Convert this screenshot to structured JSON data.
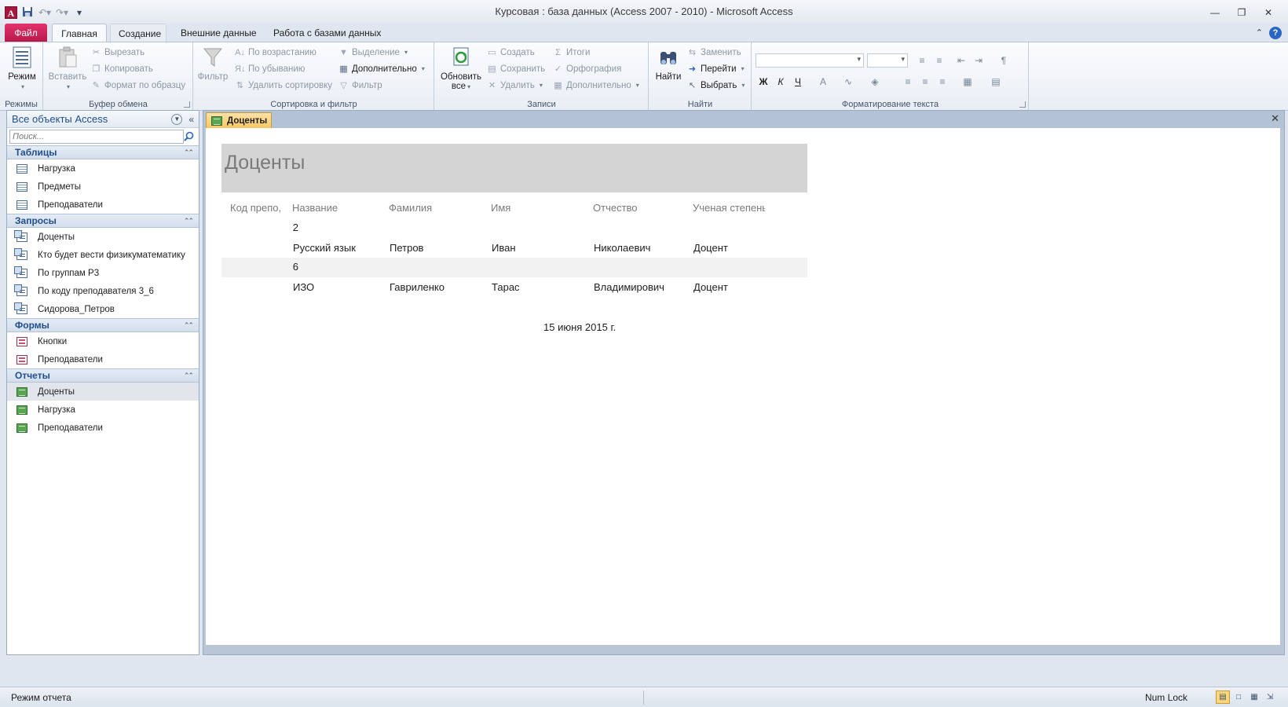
{
  "window": {
    "title": "Курсовая : база данных (Access 2007 - 2010)  -  Microsoft Access",
    "app_logo": "A",
    "controls": [
      "minimize-icon",
      "restore-icon",
      "close-icon"
    ]
  },
  "tabs": {
    "file": "Файл",
    "home": "Главная",
    "create": "Создание",
    "external": "Внешние данные",
    "dbtools": "Работа с базами данных"
  },
  "ribbon": {
    "views": {
      "mode": "Режим",
      "group": "Режимы"
    },
    "clipboard": {
      "paste": "Вставить",
      "cut": "Вырезать",
      "copy": "Копировать",
      "format_painter": "Формат по образцу",
      "group": "Буфер обмена"
    },
    "sort": {
      "filter": "Фильтр",
      "ascending": "По возрастанию",
      "descending": "По убыванию",
      "remove_sort": "Удалить сортировку",
      "selection": "Выделение",
      "advanced": "Дополнительно",
      "toggle_filter": "Фильтр",
      "group": "Сортировка и фильтр"
    },
    "records": {
      "refresh_line1": "Обновить",
      "refresh_line2": "все",
      "new": "Создать",
      "save": "Сохранить",
      "delete": "Удалить",
      "totals": "Итоги",
      "spelling": "Орфография",
      "more": "Дополнительно",
      "group": "Записи"
    },
    "find": {
      "find": "Найти",
      "replace": "Заменить",
      "goto": "Перейти",
      "select": "Выбрать",
      "group": "Найти"
    },
    "text_format": {
      "bold": "Ж",
      "italic": "К",
      "underline": "Ч",
      "group": "Форматирование текста"
    }
  },
  "nav": {
    "title": "Все объекты Access",
    "search_placeholder": "Поиск...",
    "sections": [
      {
        "label": "Таблицы",
        "items": [
          "Нагрузка",
          "Предметы",
          "Преподаватели"
        ]
      },
      {
        "label": "Запросы",
        "items": [
          "Доценты",
          "Кто будет вести физикуматематику",
          "По группам Р3",
          "По коду преподавателя 3_6",
          "Сидорова_Петров"
        ]
      },
      {
        "label": "Формы",
        "items": [
          "Кнопки",
          "Преподаватели"
        ]
      },
      {
        "label": "Отчеты",
        "items": [
          "Доценты",
          "Нагрузка",
          "Преподаватели"
        ]
      }
    ]
  },
  "document": {
    "tab_label": "Доценты",
    "report": {
      "title": "Доценты",
      "columns": [
        "Код препо,",
        "Название",
        "Фамилия",
        "Имя",
        "Отчество",
        "Ученая степень"
      ],
      "groups": [
        {
          "code": "2",
          "subject": "Русский язык",
          "last_name": "Петров",
          "first_name": "Иван",
          "patronymic": "Николаевич",
          "degree": "Доцент"
        },
        {
          "code": "6",
          "subject": "ИЗО",
          "last_name": "Гавриленко",
          "first_name": "Тарас",
          "patronymic": "Владимирович",
          "degree": "Доцент"
        }
      ],
      "date": "15 июня 2015 г."
    }
  },
  "status": {
    "mode": "Режим отчета",
    "numlock": "Num Lock"
  }
}
